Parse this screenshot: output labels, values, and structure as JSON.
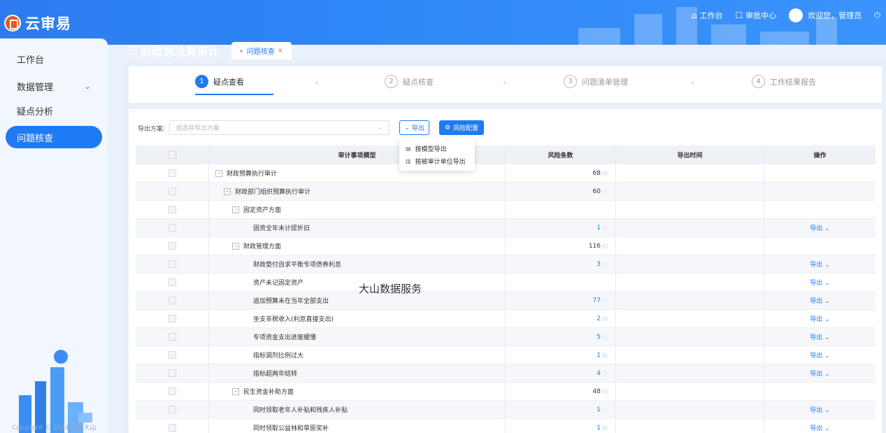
{
  "app": {
    "name": "云审易"
  },
  "header": {
    "workbench": "工作台",
    "approval_center": "审批中心",
    "welcome": "欢迎您，管理员"
  },
  "sidebar": {
    "items": [
      {
        "label": "工作台"
      },
      {
        "label": "数据管理"
      },
      {
        "label": "疑点分析"
      },
      {
        "label": "问题核查"
      }
    ],
    "copyright": "Copyright © 2024 陕西大山"
  },
  "page": {
    "title": "财政总决算审计",
    "tab": "问题核查"
  },
  "steps": [
    {
      "num": "1",
      "label": "疑点查看"
    },
    {
      "num": "2",
      "label": "疑点核查"
    },
    {
      "num": "3",
      "label": "问题清单管理"
    },
    {
      "num": "4",
      "label": "工作结果报告"
    }
  ],
  "toolbar": {
    "export_plan_label": "导出方案:",
    "select_placeholder": "请选择导出方案",
    "export_btn": "导出",
    "risk_config_btn": "风险配置"
  },
  "dropdown": {
    "items": [
      "按模型导出",
      "按被审计单位导出"
    ]
  },
  "table": {
    "headers": {
      "model": "审计事项模型",
      "risk": "风险条数",
      "time": "导出时间",
      "op": "操作"
    },
    "op_label": "导出",
    "rows": [
      {
        "name": "财政预算执行审计",
        "risk": "68",
        "level": 1,
        "toggle": "-",
        "op": false,
        "blue": false
      },
      {
        "name": "财政部门组织预算执行审计",
        "risk": "60",
        "level": 2,
        "toggle": "-",
        "op": false,
        "blue": false
      },
      {
        "name": "固定资产方面",
        "risk": "",
        "level": 3,
        "toggle": "-",
        "op": false,
        "blue": false
      },
      {
        "name": "固资全年未计提折旧",
        "risk": "1",
        "level": 4,
        "toggle": "",
        "op": true,
        "blue": true
      },
      {
        "name": "财政管理方面",
        "risk": "116",
        "level": 3,
        "toggle": "-",
        "op": false,
        "blue": false
      },
      {
        "name": "财政垫付自求平衡专项债券利息",
        "risk": "3",
        "level": 4,
        "toggle": "",
        "op": true,
        "blue": true
      },
      {
        "name": "资产未记固定资产",
        "risk": "",
        "level": 4,
        "toggle": "",
        "op": true,
        "blue": true
      },
      {
        "name": "追加预算未在当年全部支出",
        "risk": "77",
        "level": 4,
        "toggle": "",
        "op": true,
        "blue": true
      },
      {
        "name": "坐支非税收入(利息直接支出)",
        "risk": "2",
        "level": 4,
        "toggle": "",
        "op": true,
        "blue": true
      },
      {
        "name": "专项资金支出进度缓慢",
        "risk": "5",
        "level": 4,
        "toggle": "",
        "op": true,
        "blue": true
      },
      {
        "name": "指标调剂比例过大",
        "risk": "1",
        "level": 4,
        "toggle": "",
        "op": true,
        "blue": true
      },
      {
        "name": "指标超两年结转",
        "risk": "4",
        "level": 4,
        "toggle": "",
        "op": true,
        "blue": true
      },
      {
        "name": "民生资金补助方面",
        "risk": "48",
        "level": 3,
        "toggle": "-",
        "op": false,
        "blue": false
      },
      {
        "name": "同时领取老年人补贴和残疾人补贴",
        "risk": "1",
        "level": 4,
        "toggle": "",
        "op": true,
        "blue": true
      },
      {
        "name": "同时领取公益林和草原奖补",
        "risk": "1",
        "level": 4,
        "toggle": "",
        "op": true,
        "blue": true
      }
    ]
  },
  "watermark": "大山数据服务",
  "colors": {
    "primary": "#1e7bf3",
    "header": "#2f86f6"
  }
}
